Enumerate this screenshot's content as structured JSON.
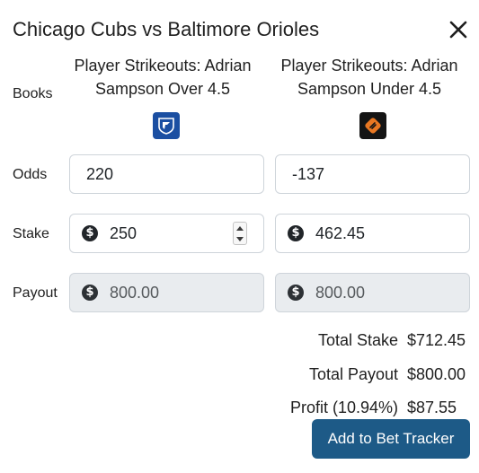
{
  "modal": {
    "title": "Chicago Cubs vs Baltimore Orioles"
  },
  "labels": {
    "books": "Books",
    "odds": "Odds",
    "stake": "Stake",
    "payout": "Payout"
  },
  "bets": [
    {
      "title": "Player Strikeouts: Adrian Sampson Over 4.5",
      "book_icon": "fanduel-logo-icon",
      "odds": "220",
      "stake": "250",
      "payout": "800.00"
    },
    {
      "title": "Player Strikeouts: Adrian Sampson Under 4.5",
      "book_icon": "fanatics-logo-icon",
      "odds": "-137",
      "stake": "462.45",
      "payout": "800.00"
    }
  ],
  "summary": {
    "total_stake_label": "Total Stake",
    "total_stake": "$712.45",
    "total_payout_label": "Total Payout",
    "total_payout": "$800.00",
    "profit_label": "Profit (10.94%)",
    "profit": "$87.55"
  },
  "actions": {
    "add_label": "Add to Bet Tracker"
  },
  "colors": {
    "primary_button": "#1d5a87",
    "readonly_field": "#e9ecef",
    "fanduel_blue": "#1b4fa2",
    "fanatics_dark": "#141414"
  }
}
